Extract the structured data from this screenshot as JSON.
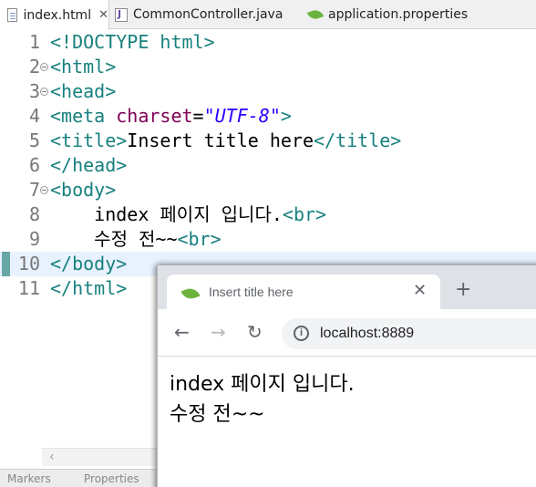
{
  "editor_tabs": [
    {
      "label": "index.html",
      "active": true
    },
    {
      "label": "CommonController.java",
      "active": false
    },
    {
      "label": "application.properties",
      "active": false
    }
  ],
  "code_lines": [
    {
      "num": "1",
      "tokens": [
        {
          "c": "tag",
          "t": "<!DOCTYPE html>"
        }
      ]
    },
    {
      "num": "2",
      "fold": true,
      "tokens": [
        {
          "c": "tag",
          "t": "<html>"
        }
      ]
    },
    {
      "num": "3",
      "fold": true,
      "tokens": [
        {
          "c": "tag",
          "t": "<head>"
        }
      ]
    },
    {
      "num": "4",
      "tokens": [
        {
          "c": "tag",
          "t": "<meta "
        },
        {
          "c": "attr",
          "t": "charset"
        },
        {
          "c": "txt",
          "t": "="
        },
        {
          "c": "str",
          "t": "\"UTF-8\""
        },
        {
          "c": "tag",
          "t": ">"
        }
      ]
    },
    {
      "num": "5",
      "tokens": [
        {
          "c": "tag",
          "t": "<title>"
        },
        {
          "c": "txt",
          "t": "Insert title here"
        },
        {
          "c": "tag",
          "t": "</title>"
        }
      ]
    },
    {
      "num": "6",
      "tokens": [
        {
          "c": "tag",
          "t": "</head>"
        }
      ]
    },
    {
      "num": "7",
      "fold": true,
      "tokens": [
        {
          "c": "tag",
          "t": "<body>"
        }
      ]
    },
    {
      "num": "8",
      "tokens": [
        {
          "c": "txt",
          "t": "    index 페이지 입니다."
        },
        {
          "c": "tag",
          "t": "<br>"
        }
      ]
    },
    {
      "num": "9",
      "tokens": [
        {
          "c": "txt",
          "t": "    수정 전~~"
        },
        {
          "c": "tag",
          "t": "<br>"
        }
      ]
    },
    {
      "num": "10",
      "current": true,
      "tokens": [
        {
          "c": "tag",
          "t": "</body>"
        }
      ]
    },
    {
      "num": "11",
      "tokens": [
        {
          "c": "tag",
          "t": "</html>"
        }
      ]
    }
  ],
  "bottom_panel": [
    "Markers",
    "Properties"
  ],
  "browser": {
    "tab_title": "Insert title here",
    "url": "localhost:8889",
    "page_lines": [
      "index 페이지 입니다.",
      "수정 전~~"
    ]
  }
}
